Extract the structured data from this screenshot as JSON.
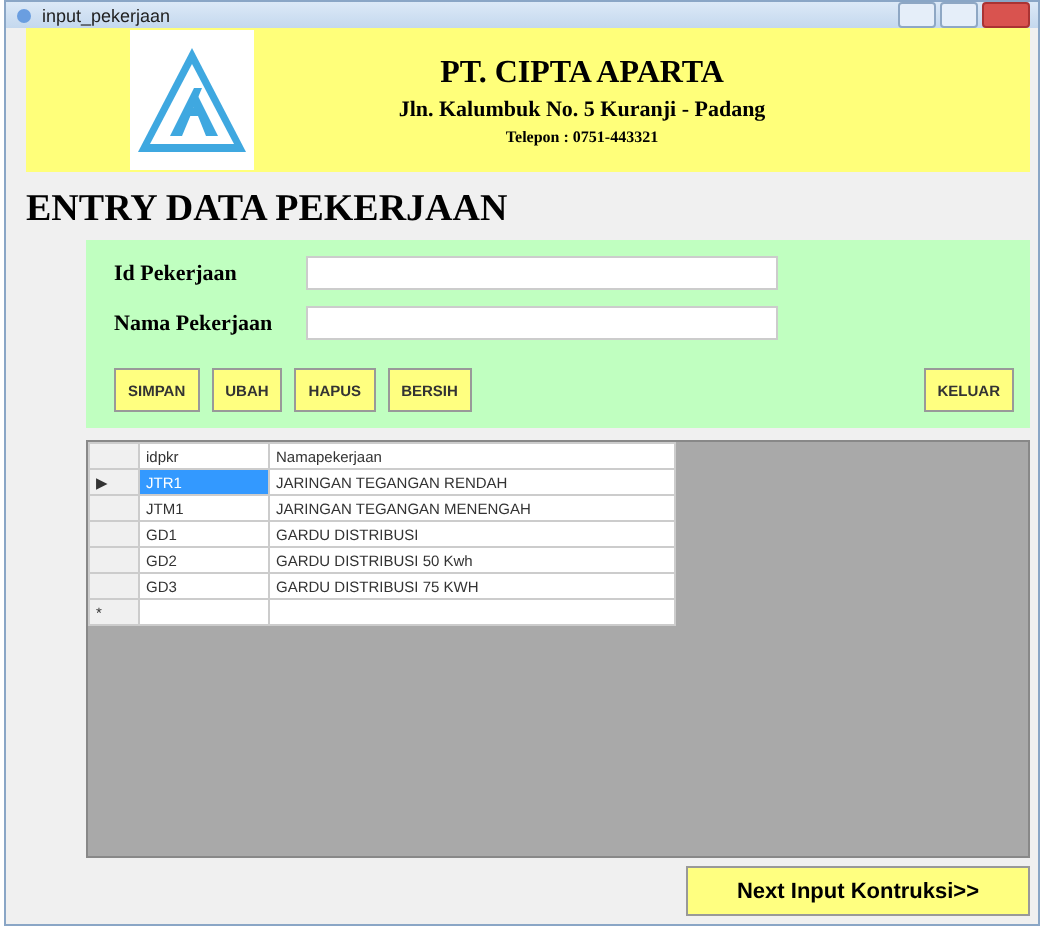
{
  "window": {
    "title": "input_pekerjaan"
  },
  "header": {
    "company": "PT. CIPTA APARTA",
    "address": "Jln. Kalumbuk No. 5 Kuranji - Padang",
    "phone": "Telepon : 0751-443321"
  },
  "heading": "ENTRY DATA PEKERJAAN",
  "form": {
    "fields": [
      {
        "label": "Id Pekerjaan"
      },
      {
        "label": "Nama Pekerjaan"
      }
    ],
    "buttons": [
      "SIMPAN",
      "UBAH",
      "HAPUS",
      "BERSIH"
    ],
    "exit_button": "KELUAR"
  },
  "table": {
    "columns": [
      "idpkr",
      "Namapekerjaan"
    ],
    "rows": [
      {
        "marker": "▶",
        "cells": [
          "JTR1",
          "JARINGAN TEGANGAN RENDAH"
        ],
        "selected": true
      },
      {
        "marker": "",
        "cells": [
          "JTM1",
          "JARINGAN TEGANGAN MENENGAH"
        ],
        "selected": false
      },
      {
        "marker": "",
        "cells": [
          "GD1",
          "GARDU DISTRIBUSI"
        ],
        "selected": false
      },
      {
        "marker": "",
        "cells": [
          "GD2",
          "GARDU DISTRIBUSI 50 Kwh"
        ],
        "selected": false
      },
      {
        "marker": "",
        "cells": [
          "GD3",
          "GARDU DISTRIBUSI 75 KWH"
        ],
        "selected": false
      }
    ],
    "new_row_marker": "*"
  },
  "next_button": "Next Input Kontruksi>>"
}
